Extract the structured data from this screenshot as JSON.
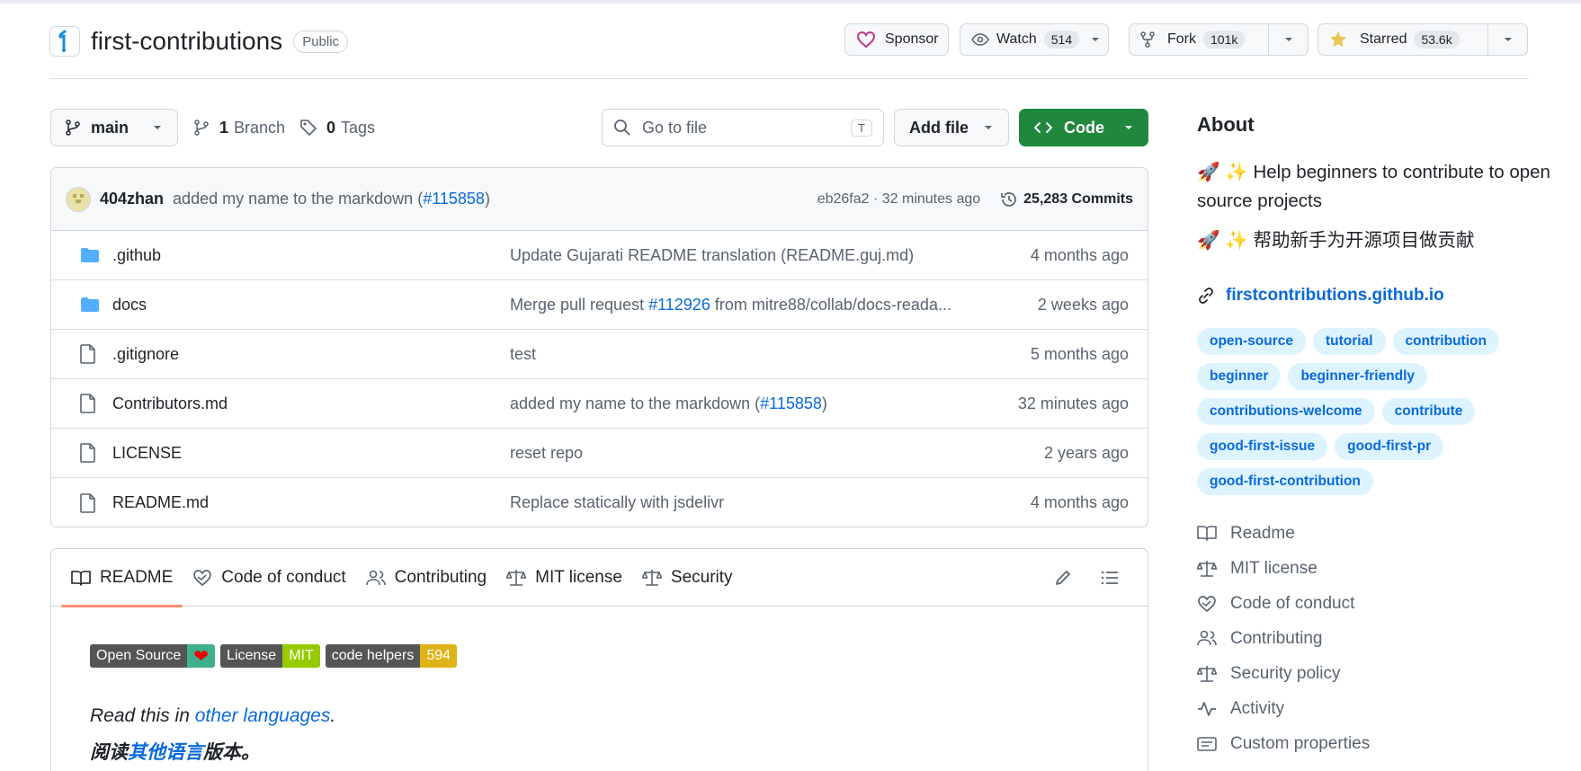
{
  "repo": {
    "name": "first-contributions",
    "visibility": "Public"
  },
  "actions": {
    "sponsor": "Sponsor",
    "watch": "Watch",
    "watch_count": "514",
    "fork": "Fork",
    "fork_count": "101k",
    "star": "Starred",
    "star_count": "53.6k"
  },
  "toolbar": {
    "branch": "main",
    "branches_count": "1",
    "branches_label": "Branch",
    "tags_count": "0",
    "tags_label": "Tags",
    "search_placeholder": "Go to file",
    "search_shortcut": "T",
    "add_file": "Add file",
    "code": "Code"
  },
  "latest_commit": {
    "author": "404zhan",
    "message_pre": "added my name to the markdown (",
    "pr": "#115858",
    "message_post": ")",
    "sha_time": "eb26fa2 · 32 minutes ago",
    "commits": "25,283 Commits"
  },
  "files": [
    {
      "name": ".github",
      "type": "folder",
      "msg_pre": "Update Gujarati README translation (README.guj.md)",
      "pr": "",
      "msg_post": "",
      "age": "4 months ago"
    },
    {
      "name": "docs",
      "type": "folder",
      "msg_pre": "Merge pull request ",
      "pr": "#112926",
      "msg_post": " from mitre88/collab/docs-reada...",
      "age": "2 weeks ago"
    },
    {
      "name": ".gitignore",
      "type": "file",
      "msg_pre": "test",
      "pr": "",
      "msg_post": "",
      "age": "5 months ago"
    },
    {
      "name": "Contributors.md",
      "type": "file",
      "msg_pre": "added my name to the markdown (",
      "pr": "#115858",
      "msg_post": ")",
      "age": "32 minutes ago"
    },
    {
      "name": "LICENSE",
      "type": "file",
      "msg_pre": "reset repo",
      "pr": "",
      "msg_post": "",
      "age": "2 years ago"
    },
    {
      "name": "README.md",
      "type": "file",
      "msg_pre": "Replace statically with jsdelivr",
      "pr": "",
      "msg_post": "",
      "age": "4 months ago"
    }
  ],
  "readme": {
    "tabs": [
      "README",
      "Code of conduct",
      "Contributing",
      "MIT license",
      "Security"
    ],
    "badges": [
      {
        "left": "Open Source",
        "right": "❤",
        "color": "#3eb08d"
      },
      {
        "left": "License",
        "right": "MIT",
        "color": "#97ca00"
      },
      {
        "left": "code helpers",
        "right": "594",
        "color": "#dfb317"
      }
    ],
    "line1_pre": "Read this in ",
    "line1_link": "other languages",
    "line1_post": ".",
    "line2_pre": "阅读",
    "line2_link": "其他语言",
    "line2_post": "版本。"
  },
  "about": {
    "heading": "About",
    "desc_en": "🚀 ✨ Help beginners to contribute to open source projects",
    "desc_zh": "🚀 ✨ 帮助新手为开源项目做贡献",
    "website": "firstcontributions.github.io",
    "topics": [
      "open-source",
      "tutorial",
      "contribution",
      "beginner",
      "beginner-friendly",
      "contributions-welcome",
      "contribute",
      "good-first-issue",
      "good-first-pr",
      "good-first-contribution"
    ],
    "links": [
      {
        "label": "Readme",
        "icon": "book-icon"
      },
      {
        "label": "MIT license",
        "icon": "law-icon"
      },
      {
        "label": "Code of conduct",
        "icon": "heart-hand-icon"
      },
      {
        "label": "Contributing",
        "icon": "people-icon"
      },
      {
        "label": "Security policy",
        "icon": "law-icon"
      },
      {
        "label": "Activity",
        "icon": "pulse-icon"
      },
      {
        "label": "Custom properties",
        "icon": "note-icon"
      }
    ]
  },
  "colors": {
    "accent": "#0969da",
    "code_green": "#1f883d",
    "tab_underline": "#fd8c73",
    "topic_bg": "#ddf4ff"
  }
}
